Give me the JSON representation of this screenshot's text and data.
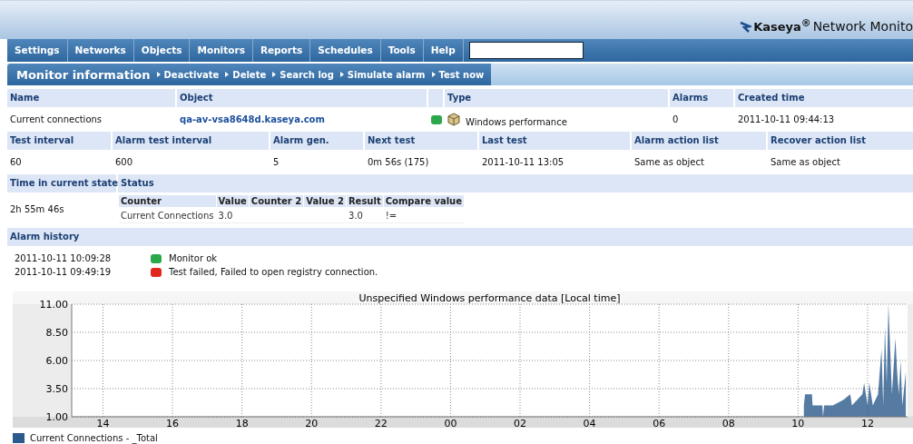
{
  "logo": {
    "brand": "Kaseya$^{®}$",
    "product": "Network Monito"
  },
  "menu": [
    {
      "label": "Settings"
    },
    {
      "label": "Networks"
    },
    {
      "label": "Objects"
    },
    {
      "label": "Monitors"
    },
    {
      "label": "Reports"
    },
    {
      "label": "Schedules"
    },
    {
      "label": "Tools"
    },
    {
      "label": "Help"
    }
  ],
  "subnav": {
    "title": "Monitor information",
    "actions": [
      {
        "label": "Deactivate"
      },
      {
        "label": "Delete"
      },
      {
        "label": "Search log"
      },
      {
        "label": "Simulate alarm"
      },
      {
        "label": "Test now"
      }
    ]
  },
  "info_rows": [
    {
      "headers": [
        {
          "label": "Name"
        },
        {
          "label": "Object"
        },
        {
          "kind": "blank"
        },
        {
          "label": "Type"
        },
        {
          "label": "Alarms"
        },
        {
          "label": "Created time"
        }
      ],
      "values": [
        {
          "text": "Current connections"
        },
        {
          "text": "qa-av-vsa8648d.kaseya.com",
          "kind": "link"
        },
        {
          "kind": "status",
          "color": "#2aa84a"
        },
        {
          "text": "Windows performance",
          "kind": "type"
        },
        {
          "text": "0"
        },
        {
          "text": "2011-10-11 09:44:13"
        }
      ]
    },
    {
      "headers": [
        {
          "label": "Test interval"
        },
        {
          "label": "Alarm test interval"
        },
        {
          "label": "Alarm gen."
        },
        {
          "label": "Next test"
        },
        {
          "label": "Last test"
        },
        {
          "label": "Alarm action list"
        },
        {
          "label": "Recover action list"
        }
      ],
      "values": [
        {
          "text": "60"
        },
        {
          "text": "600"
        },
        {
          "text": "5"
        },
        {
          "text": "0m 56s (175)"
        },
        {
          "text": "2011-10-11 13:05"
        },
        {
          "text": "Same as object"
        },
        {
          "text": "Same as object"
        }
      ]
    }
  ],
  "state": {
    "headers": [
      "Time in current state",
      "Status"
    ],
    "time": "2h 55m 46s",
    "status_table": {
      "columns": [
        "Counter",
        "Value",
        "Counter 2",
        "Value 2",
        "Result",
        "Compare value"
      ],
      "rows": [
        [
          "Current Connections",
          "3.0",
          "",
          "",
          "3.0",
          "!="
        ]
      ]
    }
  },
  "alarm_history": {
    "title": "Alarm history",
    "entries": [
      {
        "time": "2011-10-11 10:09:28",
        "color": "#2aa84a",
        "message": "Monitor ok"
      },
      {
        "time": "2011-10-11 09:49:19",
        "color": "#e0281c",
        "message": "Test failed, Failed to open registry connection."
      }
    ]
  },
  "chart": {
    "chart_data": {
      "type": "area",
      "title": "Unspecified Windows performance data [Local time]",
      "grid": true,
      "xlim": [
        "2011-10-10T13:06",
        "2011-10-11T13:09"
      ],
      "ylim": [
        1,
        11
      ],
      "xticks": [
        {
          "value": "2011-10-10T14:00",
          "label": "14"
        },
        {
          "value": "2011-10-10T16:00",
          "label": "16"
        },
        {
          "value": "2011-10-10T18:00",
          "label": "18"
        },
        {
          "value": "2011-10-10T20:00",
          "label": "20"
        },
        {
          "value": "2011-10-10T22:00",
          "label": "22"
        },
        {
          "value": "2011-10-11T00:00",
          "label": "00"
        },
        {
          "value": "2011-10-11T02:00",
          "label": "02"
        },
        {
          "value": "2011-10-11T04:00",
          "label": "04"
        },
        {
          "value": "2011-10-11T06:00",
          "label": "06"
        },
        {
          "value": "2011-10-11T08:00",
          "label": "08"
        },
        {
          "value": "2011-10-11T10:00",
          "label": "10"
        },
        {
          "value": "2011-10-11T12:00",
          "label": "12"
        }
      ],
      "yticks": [
        {
          "value": 1,
          "label": "1.00"
        },
        {
          "value": 3.5,
          "label": "3.50"
        },
        {
          "value": 6,
          "label": "6.00"
        },
        {
          "value": 8.5,
          "label": "8.50"
        },
        {
          "value": 11,
          "label": "11.00"
        }
      ],
      "x": [
        "2011-10-11T10:10",
        "2011-10-11T10:12",
        "2011-10-11T10:24",
        "2011-10-11T10:25",
        "2011-10-11T10:42",
        "2011-10-11T10:43",
        "2011-10-11T10:45",
        "2011-10-11T11:00",
        "2011-10-11T11:18",
        "2011-10-11T11:30",
        "2011-10-11T11:33",
        "2011-10-11T11:51",
        "2011-10-11T11:54",
        "2011-10-11T12:00",
        "2011-10-11T12:03",
        "2011-10-11T12:09",
        "2011-10-11T12:18",
        "2011-10-11T12:21",
        "2011-10-11T12:24",
        "2011-10-11T12:27",
        "2011-10-11T12:30",
        "2011-10-11T12:33",
        "2011-10-11T12:36",
        "2011-10-11T12:39",
        "2011-10-11T12:42",
        "2011-10-11T12:48",
        "2011-10-11T12:51",
        "2011-10-11T12:54",
        "2011-10-11T12:57",
        "2011-10-11T13:00",
        "2011-10-11T13:06"
      ],
      "series": [
        {
          "name": "Current Connections - _Total",
          "color": "#2b5a8c",
          "values": [
            2,
            3,
            3,
            2,
            2,
            1,
            2,
            2,
            2.5,
            3,
            2,
            3,
            4,
            2,
            4,
            2,
            3,
            5,
            7,
            2,
            9,
            4,
            11,
            7,
            3,
            8,
            5,
            3,
            6,
            2,
            5
          ]
        }
      ]
    }
  }
}
